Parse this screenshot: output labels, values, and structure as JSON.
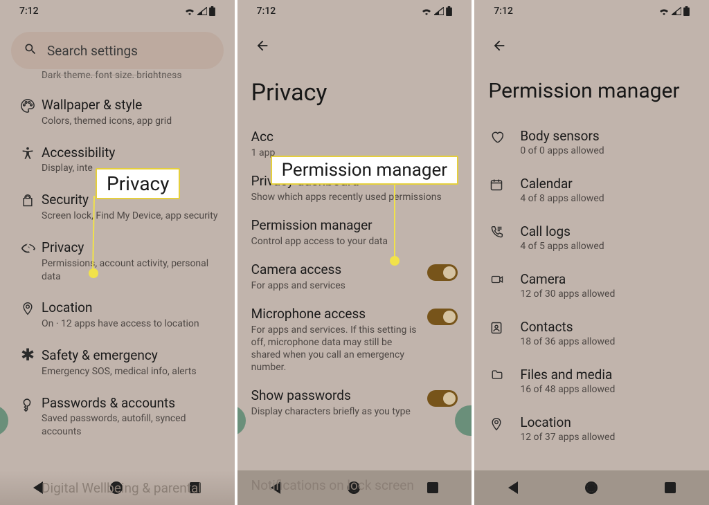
{
  "status": {
    "time": "7:12"
  },
  "panel1": {
    "search_placeholder": "Search settings",
    "truncated": "Dark theme, font size, brightness",
    "items": [
      {
        "title": "Wallpaper & style",
        "sub": "Colors, themed icons, app grid"
      },
      {
        "title": "Accessibility",
        "sub": "Display, inte"
      },
      {
        "title": "Security",
        "sub": "Screen lock, Find My Device, app security"
      },
      {
        "title": "Privacy",
        "sub": "Permissions, account activity, personal data"
      },
      {
        "title": "Location",
        "sub": "On · 12 apps have access to location"
      },
      {
        "title": "Safety & emergency",
        "sub": "Emergency SOS, medical info, alerts"
      },
      {
        "title": "Passwords & accounts",
        "sub": "Saved passwords, autofill, synced accounts"
      }
    ],
    "faded_next": "Digital Wellbeing & parental",
    "callout": "Privacy"
  },
  "panel2": {
    "title": "Privacy",
    "callout": "Permission manager",
    "items": [
      {
        "title": "Accessibility",
        "sub": "1 app"
      },
      {
        "title": "Privacy dashboard",
        "sub": "Show which apps recently used permissions"
      },
      {
        "title": "Permission manager",
        "sub": "Control app access to your data"
      },
      {
        "title": "Camera access",
        "sub": "For apps and services",
        "switch": true
      },
      {
        "title": "Microphone access",
        "sub": "For apps and services. If this setting is off, microphone data may still be shared when you call an emergency number.",
        "switch": true
      },
      {
        "title": "Show passwords",
        "sub": "Display characters briefly as you type",
        "switch": true
      }
    ],
    "faded_next": "Notifications on lock screen"
  },
  "panel3": {
    "title": "Permission manager",
    "items": [
      {
        "title": "Body sensors",
        "sub": "0 of 0 apps allowed"
      },
      {
        "title": "Calendar",
        "sub": "4 of 8 apps allowed"
      },
      {
        "title": "Call logs",
        "sub": "4 of 5 apps allowed"
      },
      {
        "title": "Camera",
        "sub": "12 of 30 apps allowed"
      },
      {
        "title": "Contacts",
        "sub": "18 of 36 apps allowed"
      },
      {
        "title": "Files and media",
        "sub": "16 of 48 apps allowed"
      },
      {
        "title": "Location",
        "sub": "12 of 37 apps allowed"
      }
    ]
  }
}
